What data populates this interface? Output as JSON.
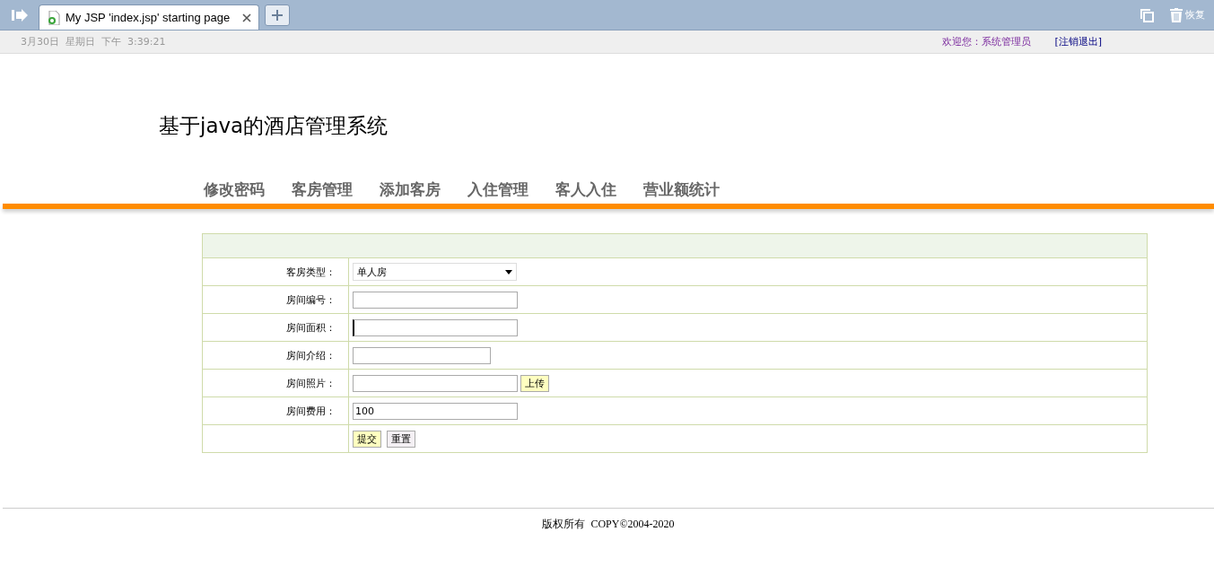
{
  "browser": {
    "tabs": [
      {
        "title": "My JSP 'index.jsp' starting page",
        "selected": true
      }
    ],
    "restore_label": "恢复"
  },
  "top_bar": {
    "date": "3月30日  星期日  下午  3:39:21",
    "welcome": "欢迎您：系统管理员",
    "logout": "[注销退出]"
  },
  "header": {
    "title": "基于java的酒店管理系统"
  },
  "nav": [
    {
      "label": "修改密码"
    },
    {
      "label": "客房管理"
    },
    {
      "label": "添加客房"
    },
    {
      "label": "入住管理"
    },
    {
      "label": "客人入住"
    },
    {
      "label": "营业额统计"
    }
  ],
  "form": {
    "rows": [
      {
        "label": "客房类型：",
        "kind": "select",
        "value": "单人房"
      },
      {
        "label": "房间编号：",
        "kind": "text"
      },
      {
        "label": "房间面积：",
        "kind": "text",
        "focused": true
      },
      {
        "label": "房间介绍：",
        "kind": "short"
      },
      {
        "label": "房间照片：",
        "kind": "upload",
        "button": "上传"
      },
      {
        "label": "房间费用：",
        "kind": "text",
        "value": "100"
      }
    ],
    "buttons": [
      {
        "label": "提交",
        "kind": "submit"
      },
      {
        "label": "重置",
        "kind": "reset"
      }
    ]
  },
  "footer": {
    "text": "版权所有  COPY©2004-2020"
  }
}
